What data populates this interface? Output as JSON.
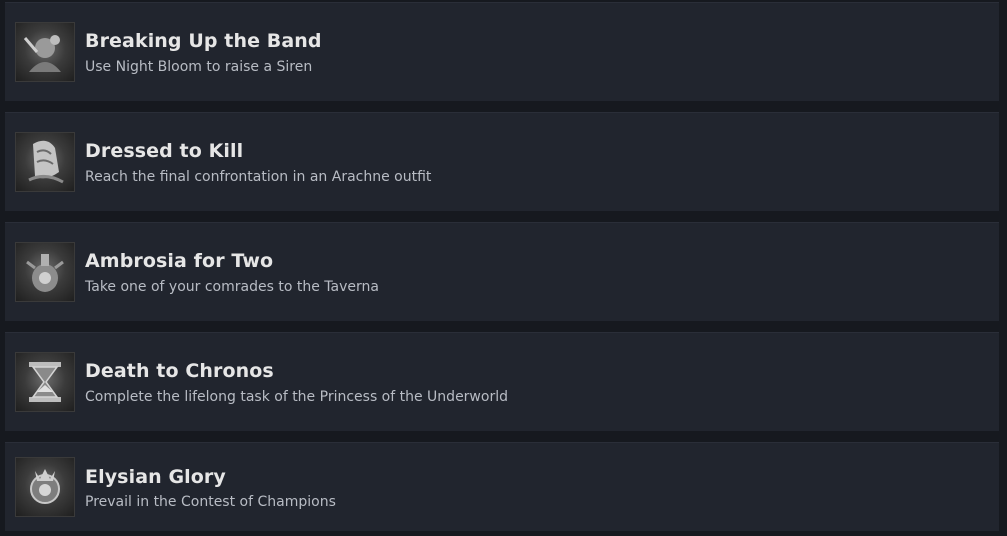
{
  "achievements": [
    {
      "title": "Breaking Up the Band",
      "description": "Use Night Bloom to raise a Siren",
      "icon": "siren-icon"
    },
    {
      "title": "Dressed to Kill",
      "description": "Reach the final confrontation in an Arachne outfit",
      "icon": "outfit-icon"
    },
    {
      "title": "Ambrosia for Two",
      "description": "Take one of your comrades to the Taverna",
      "icon": "ambrosia-icon"
    },
    {
      "title": "Death to Chronos",
      "description": "Complete the lifelong task of the Princess of the Underworld",
      "icon": "hourglass-icon"
    },
    {
      "title": "Elysian Glory",
      "description": "Prevail in the Contest of Champions",
      "icon": "champion-icon"
    }
  ],
  "colors": {
    "page_background": "#16191f",
    "card_background": "#21252e",
    "title_text": "#e6e6e6",
    "description_text": "#b8bcc4"
  }
}
